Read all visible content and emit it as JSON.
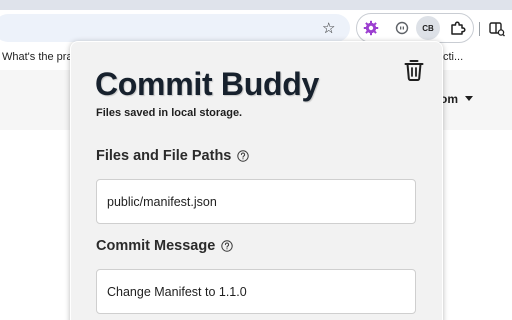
{
  "browser": {
    "bookmark_left": "What's the prac",
    "bookmark_right": "cti...",
    "extensions": {
      "active_badge": "CB"
    }
  },
  "page": {
    "menu_label": "om"
  },
  "popup": {
    "title": "Commit Buddy",
    "subtitle": "Files saved in local storage.",
    "files_label": "Files and File Paths",
    "files_value": "public/manifest.json",
    "commit_label": "Commit Message",
    "commit_value": "Change Manifest to 1.1.0"
  },
  "colors": {
    "popup_bg": "#f2f2f2",
    "title": "#17212d",
    "omnibox": "#edf2fa"
  }
}
